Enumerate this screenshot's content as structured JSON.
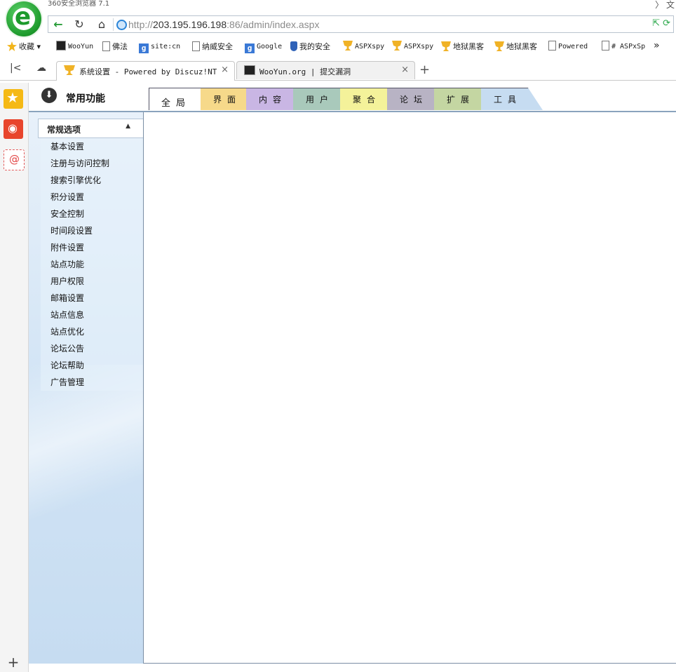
{
  "browser": {
    "title": "360安全浏览器 7.1",
    "title_right": "〉 文",
    "url_prefix": "http://",
    "url_host": "203.195.196.198",
    "url_rest": ":86/admin/index.aspx",
    "addr_icons": "⇱ ⟳"
  },
  "bookmarks": [
    {
      "icon": "star-icon",
      "label": "收藏"
    },
    {
      "icon": "wooyun-icon",
      "label": "WooYun"
    },
    {
      "icon": "page-icon",
      "label": "佛法"
    },
    {
      "icon": "google-icon",
      "label": "site:cn"
    },
    {
      "icon": "page-icon",
      "label": "纳威安全"
    },
    {
      "icon": "google-icon",
      "label": "Google"
    },
    {
      "icon": "shield-icon",
      "label": "我的安全"
    },
    {
      "icon": "trophy-icon",
      "label": "ASPXspy"
    },
    {
      "icon": "trophy-icon",
      "label": "ASPXspy"
    },
    {
      "icon": "trophy-icon",
      "label": "地狱黑客"
    },
    {
      "icon": "trophy-icon",
      "label": "地狱黑客"
    },
    {
      "icon": "page-icon",
      "label": "Powered"
    },
    {
      "icon": "page-icon",
      "label": "# ASPxSp"
    }
  ],
  "browser_tabs": [
    {
      "label": "系统设置 - Powered by Discuz!NT",
      "active": true
    },
    {
      "label": "WooYun.org | 提交漏洞",
      "active": false
    }
  ],
  "admin": {
    "section_title": "常用功能",
    "main_tabs": [
      {
        "label": "全局",
        "color": "#ffffff"
      },
      {
        "label": "界面",
        "color": "#f6d98a"
      },
      {
        "label": "内容",
        "color": "#c9b6e4"
      },
      {
        "label": "用户",
        "color": "#a9c9bb"
      },
      {
        "label": "聚合",
        "color": "#f4f29a"
      },
      {
        "label": "论坛",
        "color": "#b8b3c4"
      },
      {
        "label": "扩展",
        "color": "#c4d6a2"
      },
      {
        "label": "工具",
        "color": "#c6dcf1"
      }
    ],
    "sidebar_header": "常规选项",
    "sidebar_items": [
      "基本设置",
      "注册与访问控制",
      "搜索引擎优化",
      "积分设置",
      "安全控制",
      "时间段设置",
      "附件设置",
      "站点功能",
      "用户权限",
      "邮箱设置",
      "站点信息",
      "站点优化",
      "论坛公告",
      "论坛帮助",
      "广告管理"
    ]
  }
}
